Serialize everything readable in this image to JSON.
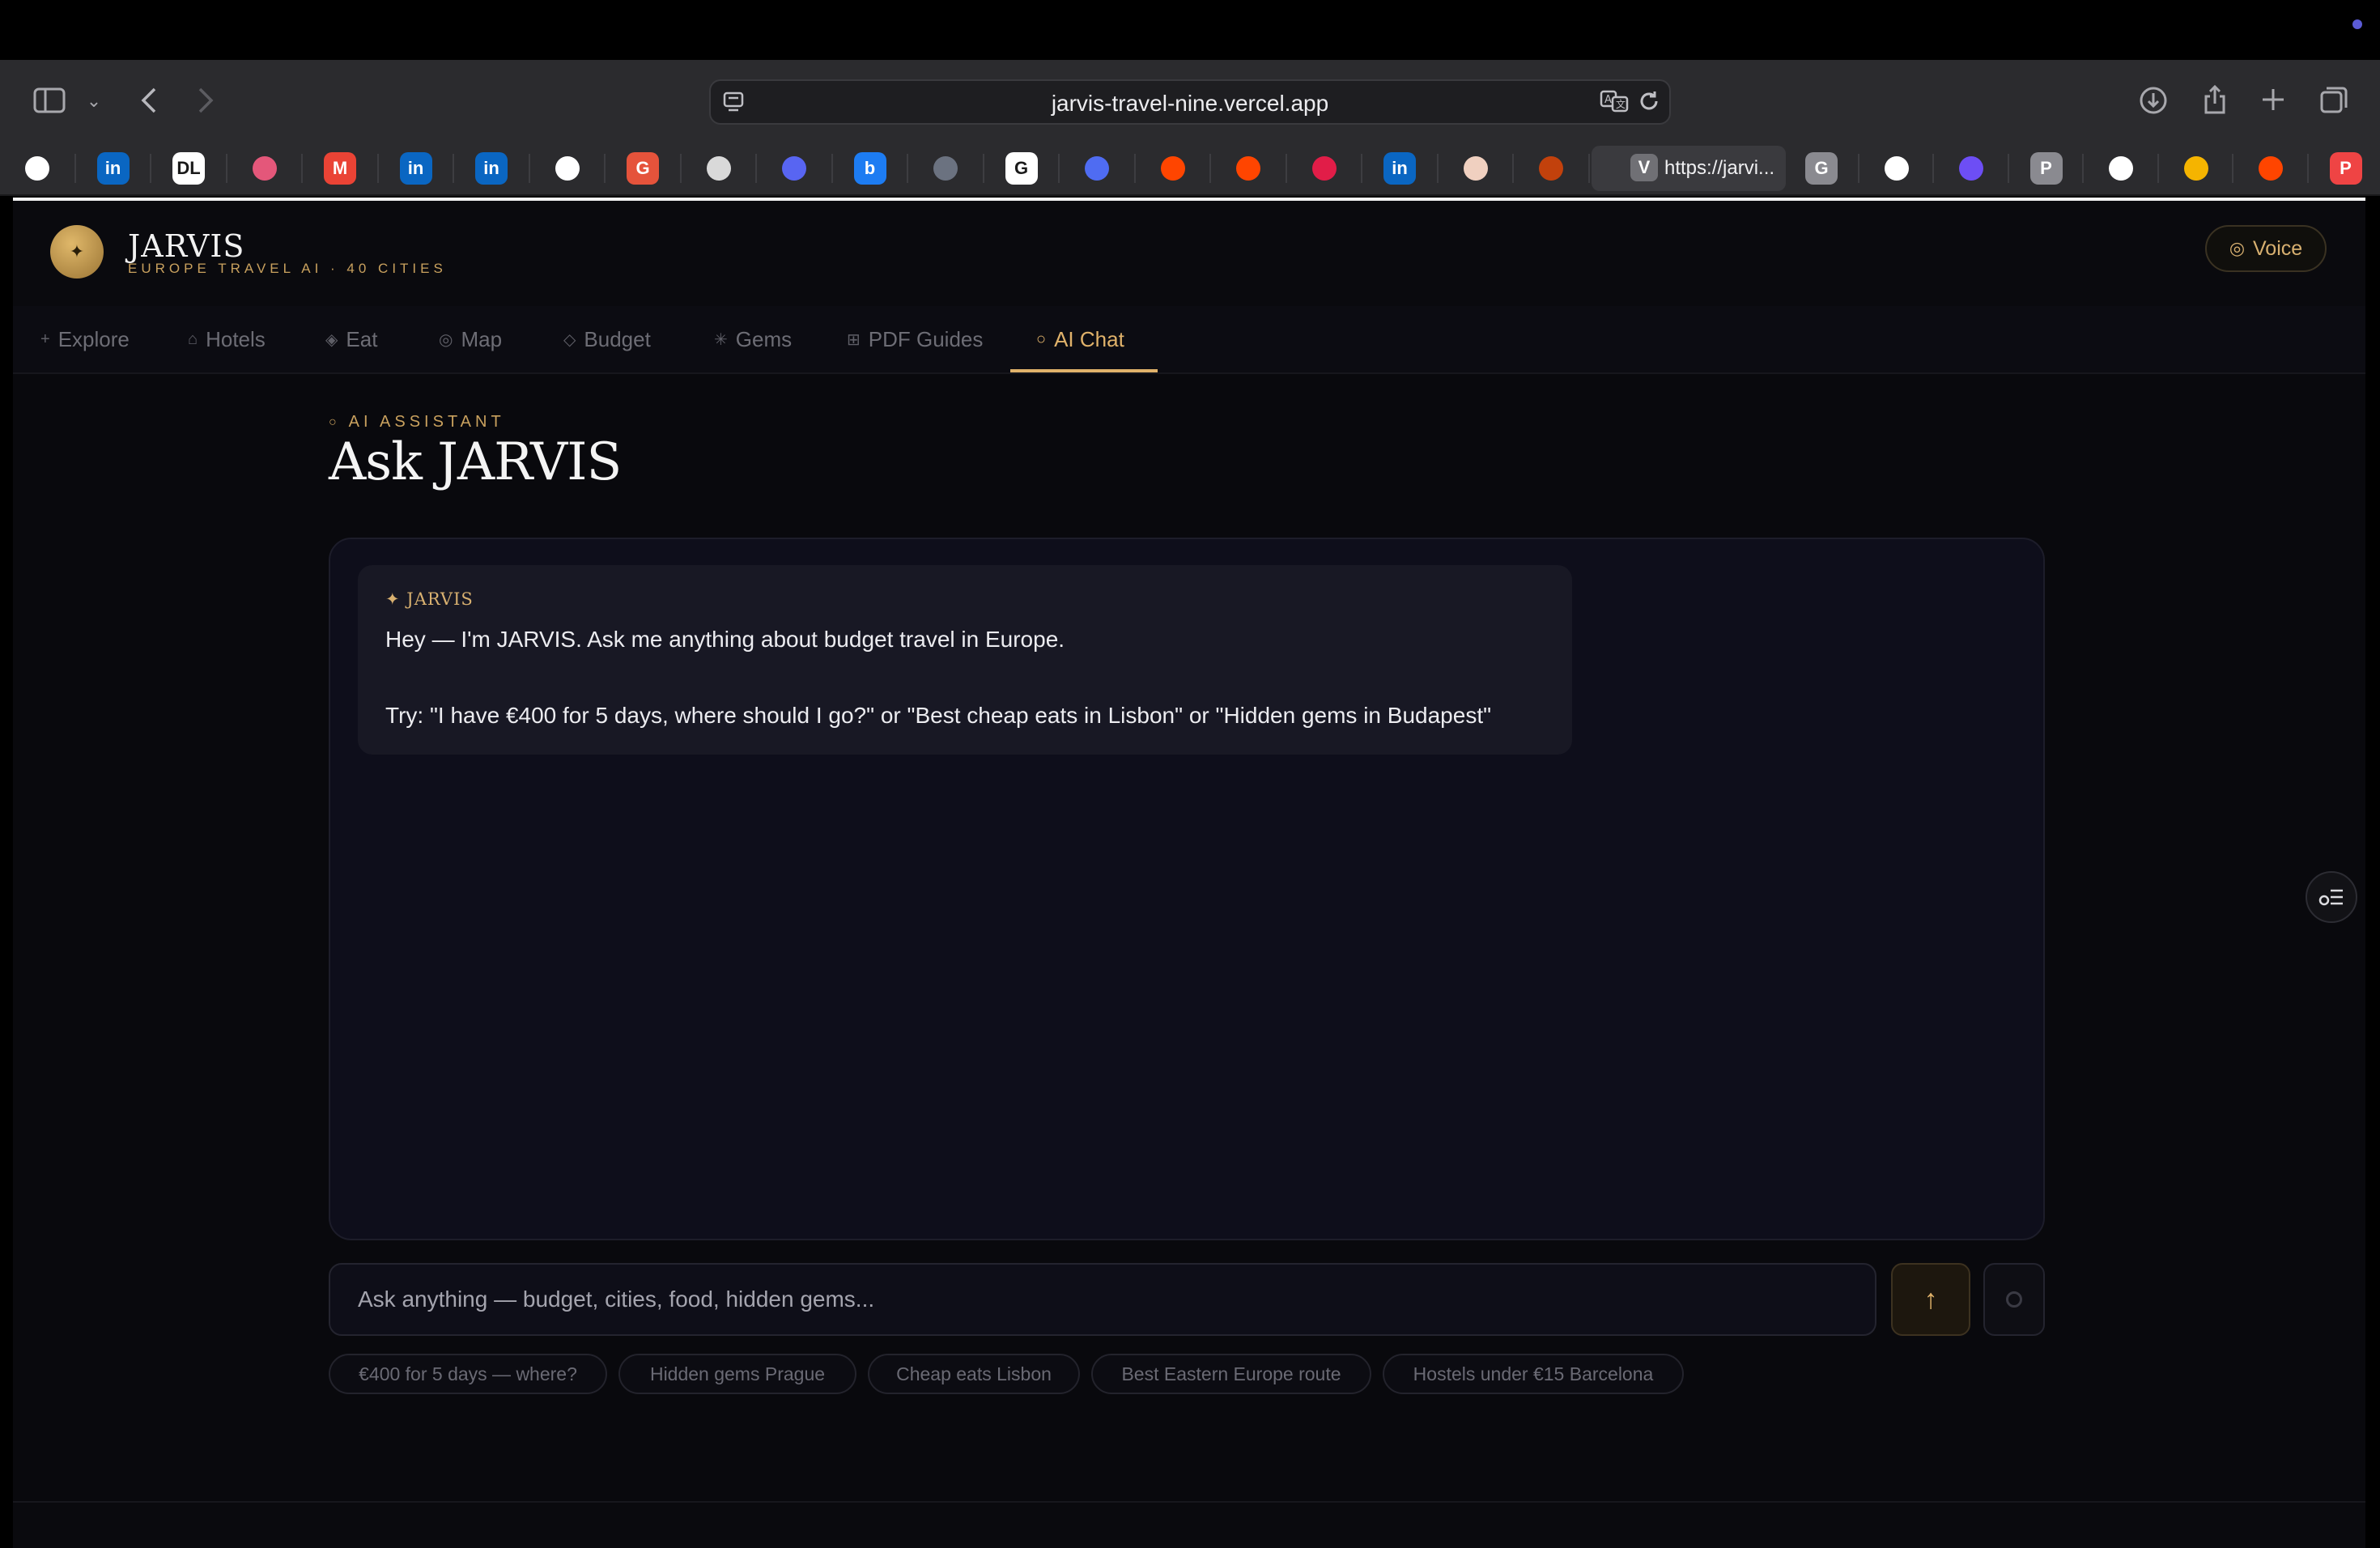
{
  "browser": {
    "url": "jarvis-travel-nine.vercel.app",
    "active_tab_title": "https://jarvi...",
    "active_tab_favicon": "V",
    "icons": [
      "sidebar-icon",
      "chevron-down-icon",
      "back-icon",
      "forward-icon",
      "download-icon",
      "share-icon",
      "new-tab-icon",
      "tab-overview-icon",
      "translate-icon",
      "reload-icon"
    ],
    "tab_favicons": [
      {
        "name": "openai",
        "color": "#ffffff",
        "letter": ""
      },
      {
        "name": "linkedin",
        "color": "#0a66c2",
        "letter": "in"
      },
      {
        "name": "dl",
        "color": "#ffffff",
        "letter": "DL"
      },
      {
        "name": "bookmark",
        "color": "#e4577a",
        "letter": ""
      },
      {
        "name": "gmail",
        "color": "#ea4335",
        "letter": "M"
      },
      {
        "name": "linkedin",
        "color": "#0a66c2",
        "letter": "in"
      },
      {
        "name": "linkedin",
        "color": "#0a66c2",
        "letter": "in"
      },
      {
        "name": "openai",
        "color": "#ffffff",
        "letter": ""
      },
      {
        "name": "g-red",
        "color": "#e5533b",
        "letter": "G"
      },
      {
        "name": "lufthansa",
        "color": "#d9d9d9",
        "letter": ""
      },
      {
        "name": "discord",
        "color": "#5865f2",
        "letter": ""
      },
      {
        "name": "booking",
        "color": "#1d7cf2",
        "letter": "b"
      },
      {
        "name": "cube",
        "color": "#6b7280",
        "letter": ""
      },
      {
        "name": "google",
        "color": "#ffffff",
        "letter": "G"
      },
      {
        "name": "chat",
        "color": "#4f6cf2",
        "letter": ""
      },
      {
        "name": "reddit",
        "color": "#ff4500",
        "letter": ""
      },
      {
        "name": "reddit",
        "color": "#ff4500",
        "letter": ""
      },
      {
        "name": "heart",
        "color": "#e11d48",
        "letter": ""
      },
      {
        "name": "linkedin",
        "color": "#0a66c2",
        "letter": "in"
      },
      {
        "name": "claude",
        "color": "#f0d0c0",
        "letter": ""
      },
      {
        "name": "claude-dark",
        "color": "#c2410c",
        "letter": ""
      }
    ],
    "tab_favicons_right": [
      {
        "name": "g-gray",
        "color": "#8a8a90",
        "letter": "G"
      },
      {
        "name": "github",
        "color": "#ffffff",
        "letter": ""
      },
      {
        "name": "purple-app",
        "color": "#6d4ef5",
        "letter": ""
      },
      {
        "name": "p-gray",
        "color": "#8a8a90",
        "letter": "P"
      },
      {
        "name": "arc",
        "color": "#ffffff",
        "letter": ""
      },
      {
        "name": "drive",
        "color": "#f5b400",
        "letter": ""
      },
      {
        "name": "reddit",
        "color": "#ff4500",
        "letter": ""
      },
      {
        "name": "p-red",
        "color": "#ef4444",
        "letter": "P"
      }
    ]
  },
  "app": {
    "brand": "JARVIS",
    "tagline": "EUROPE TRAVEL AI · 40 CITIES",
    "voice_label": "Voice",
    "nav": [
      {
        "icon": "+",
        "label": "Explore"
      },
      {
        "icon": "⌂",
        "label": "Hotels"
      },
      {
        "icon": "◈",
        "label": "Eat"
      },
      {
        "icon": "◎",
        "label": "Map"
      },
      {
        "icon": "◇",
        "label": "Budget"
      },
      {
        "icon": "✳",
        "label": "Gems"
      },
      {
        "icon": "⊞",
        "label": "PDF Guides"
      },
      {
        "icon": "○",
        "label": "AI Chat",
        "active": true
      }
    ],
    "accent_color": "#e0b26a"
  },
  "chat": {
    "eyebrow": "AI ASSISTANT",
    "title": "Ask JARVIS",
    "message": {
      "sender": "✦ JARVIS",
      "line1": "Hey — I'm JARVIS. Ask me anything about budget travel in Europe.",
      "line2": "Try: \"I have €400 for 5 days, where should I go?\" or \"Best cheap eats in Lisbon\" or \"Hidden gems in Budapest\""
    },
    "input_placeholder": "Ask anything — budget, cities, food, hidden gems...",
    "send_icon": "↑",
    "suggestions": [
      "€400 for 5 days — where?",
      "Hidden gems Prague",
      "Cheap eats Lisbon",
      "Best Eastern Europe route",
      "Hostels under €15 Barcelona"
    ]
  }
}
